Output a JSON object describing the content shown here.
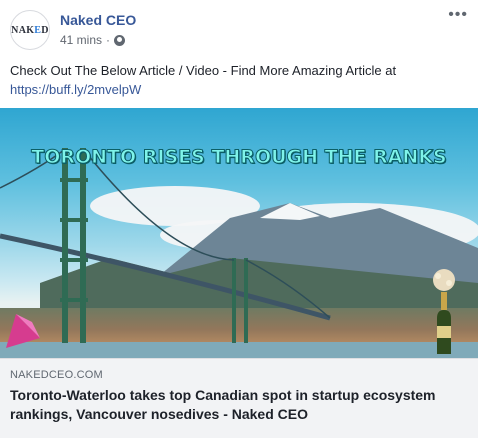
{
  "post": {
    "page_name": "Naked CEO",
    "avatar_logo_text": "NAKED",
    "timestamp": "41 mins",
    "separator": "·",
    "audience_icon": "globe-icon",
    "more_icon": "more-options-icon",
    "body_text": "Check Out The Below Article / Video - Find More Amazing Article at",
    "body_link": "https://buff.ly/2mvelpW"
  },
  "image": {
    "overlay_headline": "TORONTO RISES THROUGH THE RANKS"
  },
  "link_preview": {
    "domain": "NAKEDCEO.COM",
    "title": "Toronto-Waterloo takes top Canadian spot in startup ecosystem rankings, Vancouver nosedives - Naked CEO"
  },
  "colors": {
    "link_blue": "#385898",
    "meta_gray": "#616770",
    "preview_bg": "#f2f3f5",
    "headline_cyan": "#7ff3ea"
  }
}
